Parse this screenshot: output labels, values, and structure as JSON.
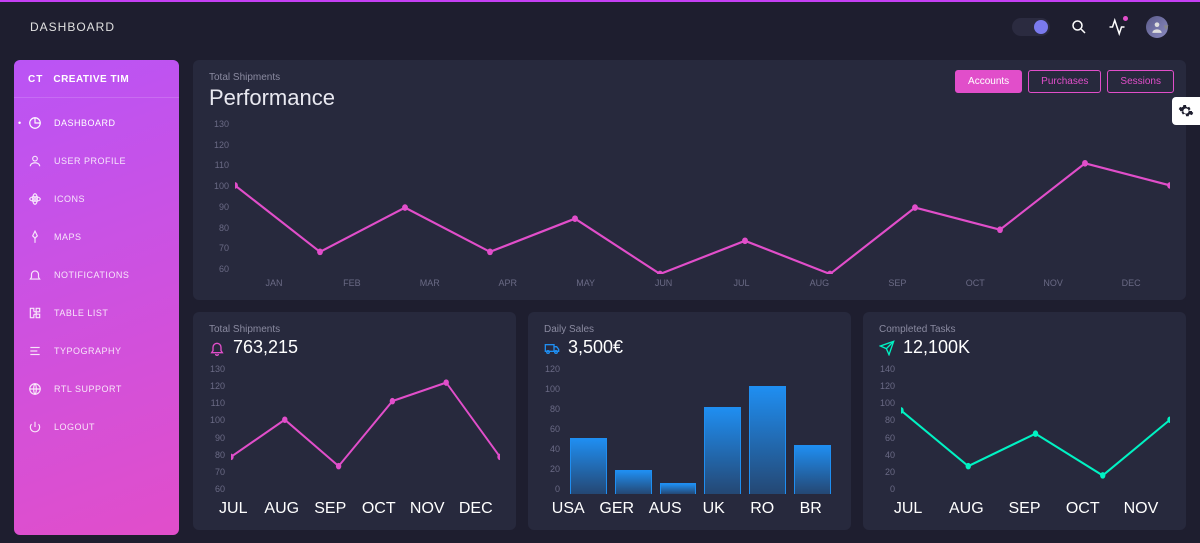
{
  "topbar": {
    "title": "DASHBOARD"
  },
  "brand": {
    "logo": "CT",
    "name": "CREATIVE TIM"
  },
  "sidebar": {
    "items": [
      {
        "label": "DASHBOARD",
        "icon": "chart-pie-icon",
        "active": true
      },
      {
        "label": "USER PROFILE",
        "icon": "user-icon"
      },
      {
        "label": "ICONS",
        "icon": "atom-icon"
      },
      {
        "label": "MAPS",
        "icon": "pin-icon"
      },
      {
        "label": "NOTIFICATIONS",
        "icon": "bell-icon"
      },
      {
        "label": "TABLE LIST",
        "icon": "puzzle-icon"
      },
      {
        "label": "TYPOGRAPHY",
        "icon": "align-icon"
      },
      {
        "label": "RTL SUPPORT",
        "icon": "globe-icon"
      },
      {
        "label": "LOGOUT",
        "icon": "power-icon"
      }
    ]
  },
  "performance": {
    "subtitle": "Total Shipments",
    "title": "Performance",
    "tabs": [
      {
        "label": "Accounts",
        "active": true
      },
      {
        "label": "Purchases"
      },
      {
        "label": "Sessions"
      }
    ]
  },
  "cards": {
    "shipments": {
      "subtitle": "Total Shipments",
      "value": "763,215"
    },
    "sales": {
      "subtitle": "Daily Sales",
      "value": "3,500€"
    },
    "tasks": {
      "subtitle": "Completed Tasks",
      "value": "12,100K"
    }
  },
  "chart_data": [
    {
      "type": "line",
      "title": "Performance",
      "subtitle": "Total Shipments",
      "series_name": "Accounts",
      "categories": [
        "JAN",
        "FEB",
        "MAR",
        "APR",
        "MAY",
        "JUN",
        "JUL",
        "AUG",
        "SEP",
        "OCT",
        "NOV",
        "DEC"
      ],
      "values": [
        100,
        70,
        90,
        70,
        85,
        60,
        75,
        60,
        90,
        80,
        110,
        100
      ],
      "ylim": [
        60,
        130
      ],
      "yticks": [
        60,
        70,
        80,
        90,
        100,
        110,
        120,
        130
      ],
      "color": "#e14eca"
    },
    {
      "type": "line",
      "title": "Total Shipments",
      "categories": [
        "JUL",
        "AUG",
        "SEP",
        "OCT",
        "NOV",
        "DEC"
      ],
      "values": [
        80,
        100,
        75,
        110,
        120,
        80
      ],
      "ylim": [
        60,
        130
      ],
      "yticks": [
        60,
        70,
        80,
        90,
        100,
        110,
        120,
        130
      ],
      "color": "#e14eca"
    },
    {
      "type": "bar",
      "title": "Daily Sales",
      "categories": [
        "USA",
        "GER",
        "AUS",
        "UK",
        "RO",
        "BR"
      ],
      "values": [
        52,
        22,
        10,
        80,
        100,
        45
      ],
      "ylim": [
        0,
        120
      ],
      "yticks": [
        0,
        20,
        40,
        60,
        80,
        100,
        120
      ],
      "color": "#1f8ef1"
    },
    {
      "type": "line",
      "title": "Completed Tasks",
      "categories": [
        "JUL",
        "AUG",
        "SEP",
        "OCT",
        "NOV"
      ],
      "values": [
        90,
        30,
        65,
        20,
        80
      ],
      "ylim": [
        0,
        140
      ],
      "yticks": [
        0,
        20,
        40,
        60,
        80,
        100,
        120,
        140
      ],
      "color": "#00f2c3"
    }
  ]
}
